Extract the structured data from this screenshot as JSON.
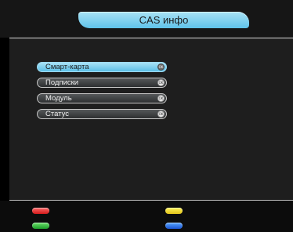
{
  "header": {
    "title": "CAS инфо"
  },
  "menu": {
    "items": [
      {
        "label": "Смарт-карта",
        "selected": true,
        "icon": "ok-icon"
      },
      {
        "label": "Подписки",
        "selected": false,
        "icon": "ok-icon"
      },
      {
        "label": "Модуль",
        "selected": false,
        "icon": "ok-icon"
      },
      {
        "label": "Статус",
        "selected": false,
        "icon": "ok-icon"
      }
    ]
  },
  "footer": {
    "keys": [
      {
        "name": "red",
        "color": "#e02a2a"
      },
      {
        "name": "yellow",
        "color": "#f2d629"
      },
      {
        "name": "green",
        "color": "#2fb43a"
      },
      {
        "name": "blue",
        "color": "#2a6ae0"
      }
    ]
  },
  "colors": {
    "accent": "#7fd0ee",
    "background": "#1e1e1e"
  }
}
